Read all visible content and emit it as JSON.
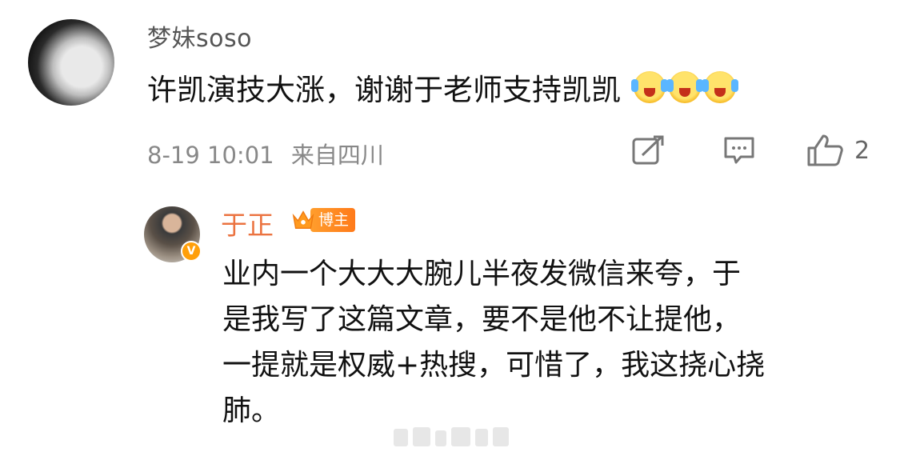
{
  "comment": {
    "username": "梦妹soso",
    "text": "许凯演技大涨，谢谢于老师支持凯凯",
    "emoji_count": 3,
    "emoji_icon": "crying-laughing-emoji",
    "date": "8-19 10:01",
    "location": "来自四川",
    "like_count": "2"
  },
  "reply": {
    "username": "于正",
    "badge_label": "博主",
    "badge_icon": "crown-icon",
    "verified_icon": "verified-v-icon",
    "lines": [
      "业内一个大大大腕儿半夜发微信来夸，于",
      "是我写了这篇文章，要不是他不让提他，",
      "一提就是权威+热搜，可惜了，我这挠心挠",
      "肺。"
    ]
  },
  "colors": {
    "reply_name": "#eb7340",
    "badge": "#ff8a1f",
    "meta_text": "#888888"
  }
}
